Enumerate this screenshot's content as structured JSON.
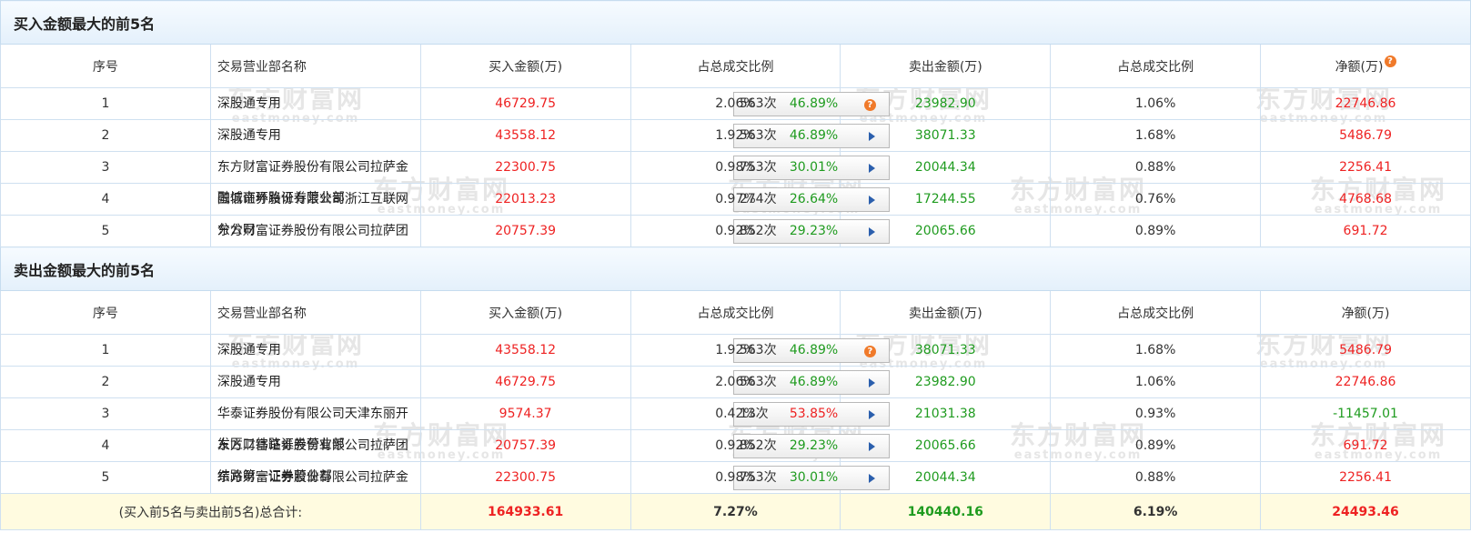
{
  "watermark": {
    "brand": "东方财富网",
    "domain": "eastmoney.com"
  },
  "buy_section": {
    "title": "买入金额最大的前5名",
    "headers": {
      "rank": "序号",
      "name": "交易营业部名称",
      "buy": "买入金额(万)",
      "buy_pct": "占总成交比例",
      "sell": "卖出金额(万)",
      "sell_pct": "占总成交比例",
      "net": "净额(万)",
      "net_help_icon": "?"
    },
    "rows": [
      {
        "rank": "1",
        "name": "深股通专用",
        "count": "563次",
        "pct": "46.89%",
        "pct_color": "green",
        "icon": "question-icon",
        "buy": "46729.75",
        "buy_pct": "2.06%",
        "sell": "23982.90",
        "sell_pct": "1.06%",
        "net": "22746.86"
      },
      {
        "rank": "2",
        "name": "深股通专用",
        "count": "563次",
        "pct": "46.89%",
        "pct_color": "green",
        "icon": "play-icon",
        "buy": "43558.12",
        "buy_pct": "1.92%",
        "sell": "38071.33",
        "sell_pct": "1.68%",
        "net": "5486.79"
      },
      {
        "rank": "3",
        "name": "东方财富证券股份有限公司拉萨金融城南环路证券营业部",
        "count": "753次",
        "pct": "30.01%",
        "pct_color": "green",
        "icon": "play-icon",
        "buy": "22300.75",
        "buy_pct": "0.98%",
        "sell": "20044.34",
        "sell_pct": "0.88%",
        "net": "2256.41"
      },
      {
        "rank": "4",
        "name": "国信证券股份有限公司浙江互联网分公司",
        "count": "274次",
        "pct": "26.64%",
        "pct_color": "green",
        "icon": "play-icon",
        "buy": "22013.23",
        "buy_pct": "0.97%",
        "sell": "17244.55",
        "sell_pct": "0.76%",
        "net": "4768.68"
      },
      {
        "rank": "5",
        "name": "东方财富证券股份有限公司拉萨团结路第一证券营业部",
        "count": "852次",
        "pct": "29.23%",
        "pct_color": "green",
        "icon": "play-icon",
        "buy": "20757.39",
        "buy_pct": "0.92%",
        "sell": "20065.66",
        "sell_pct": "0.89%",
        "net": "691.72"
      }
    ]
  },
  "sell_section": {
    "title": "卖出金额最大的前5名",
    "headers": {
      "rank": "序号",
      "name": "交易营业部名称",
      "buy": "买入金额(万)",
      "buy_pct": "占总成交比例",
      "sell": "卖出金额(万)",
      "sell_pct": "占总成交比例",
      "net": "净额(万)"
    },
    "rows": [
      {
        "rank": "1",
        "name": "深股通专用",
        "count": "563次",
        "pct": "46.89%",
        "pct_color": "green",
        "icon": "question-icon",
        "buy": "43558.12",
        "buy_pct": "1.92%",
        "sell": "38071.33",
        "sell_pct": "1.68%",
        "net": "5486.79"
      },
      {
        "rank": "2",
        "name": "深股通专用",
        "count": "563次",
        "pct": "46.89%",
        "pct_color": "green",
        "icon": "play-icon",
        "buy": "46729.75",
        "buy_pct": "2.06%",
        "sell": "23982.90",
        "sell_pct": "1.06%",
        "net": "22746.86"
      },
      {
        "rank": "3",
        "name": "华泰证券股份有限公司天津东丽开发区二纬路证券营业部",
        "count": "13次",
        "pct": "53.85%",
        "pct_color": "red",
        "icon": "play-icon",
        "buy": "9574.37",
        "buy_pct": "0.42%",
        "sell": "21031.38",
        "sell_pct": "0.93%",
        "net": "-11457.01"
      },
      {
        "rank": "4",
        "name": "东方财富证券股份有限公司拉萨团结路第一证券营业部",
        "count": "852次",
        "pct": "29.23%",
        "pct_color": "green",
        "icon": "play-icon",
        "buy": "20757.39",
        "buy_pct": "0.92%",
        "sell": "20065.66",
        "sell_pct": "0.89%",
        "net": "691.72"
      },
      {
        "rank": "5",
        "name": "东方财富证券股份有限公司拉萨金融城南环路证券营业部",
        "count": "753次",
        "pct": "30.01%",
        "pct_color": "green",
        "icon": "play-icon",
        "buy": "22300.75",
        "buy_pct": "0.98%",
        "sell": "20044.34",
        "sell_pct": "0.88%",
        "net": "2256.41"
      }
    ]
  },
  "total": {
    "label": "(买入前5名与卖出前5名)总合计:",
    "buy": "164933.61",
    "buy_pct": "7.27%",
    "sell": "140440.16",
    "sell_pct": "6.19%",
    "net": "24493.46"
  },
  "colors": {
    "buy": "#e22222",
    "sell": "#1f9b1f",
    "net_positive": "#e22222",
    "net_negative": "#1f9b1f"
  }
}
